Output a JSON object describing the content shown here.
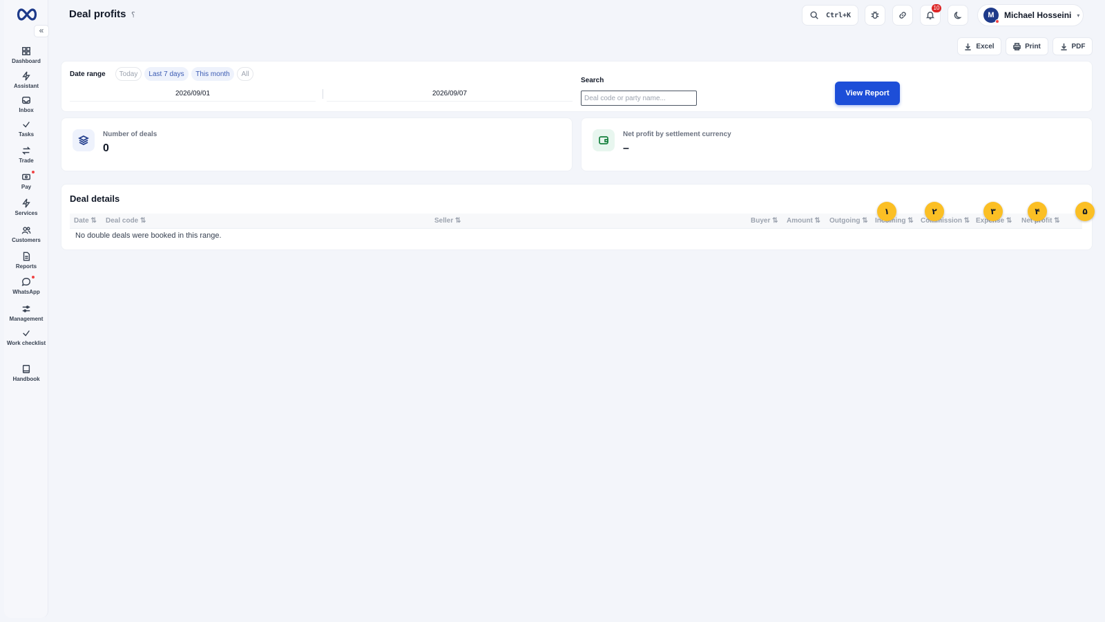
{
  "app": {
    "title": "Deal profits",
    "help": "؟"
  },
  "sidebar": {
    "collapse_label": "«",
    "items": [
      {
        "label": "Dashboard",
        "icon": "grid-icon"
      },
      {
        "label": "Assistant",
        "icon": "bolt-icon"
      },
      {
        "label": "Inbox",
        "icon": "inbox-icon"
      },
      {
        "label": "Tasks",
        "icon": "check-icon"
      },
      {
        "label": "Trade",
        "icon": "swap-icon"
      },
      {
        "label": "Pay",
        "icon": "wallet-icon"
      },
      {
        "label": "Services",
        "icon": "bolt-icon"
      },
      {
        "label": "Customers",
        "icon": "users-icon"
      },
      {
        "label": "Reports",
        "icon": "document-icon"
      },
      {
        "label": "WhatsApp",
        "icon": "chat-icon"
      },
      {
        "label": "Management",
        "icon": "sliders-icon"
      },
      {
        "label": "Work checklist",
        "icon": "check-icon"
      },
      {
        "label": "Handbook",
        "icon": "book-icon"
      }
    ]
  },
  "topbar": {
    "search_shortcut": "Ctrl+K",
    "notifications_count": "10",
    "user_initial": "M",
    "user_name": "Michael Hosseini",
    "caret": "▾"
  },
  "exports": {
    "excel": "Excel",
    "print": "Print",
    "pdf": "PDF"
  },
  "filters": {
    "date_range_label": "Date range",
    "chips": [
      {
        "label": "Today",
        "active": false
      },
      {
        "label": "Last 7 days",
        "active": true
      },
      {
        "label": "This month",
        "active": true
      },
      {
        "label": "All",
        "active": false
      }
    ],
    "date_from": "2026/09/01",
    "date_to": "2026/09/07",
    "search_label": "Search",
    "search_placeholder": "Deal code or party name...",
    "search_value": "",
    "view_report": "View Report"
  },
  "stats": [
    {
      "label": "Number of deals",
      "value": "0"
    },
    {
      "label": "Net profit by settlement currency",
      "value": "–"
    }
  ],
  "details": {
    "title": "Deal details",
    "columns": [
      "Date ⇅",
      "Deal code ⇅",
      "Seller ⇅",
      "Buyer ⇅",
      "Amount ⇅",
      "Outgoing ⇅",
      "Incoming ⇅",
      "Commission ⇅",
      "Expense ⇅",
      "Net profit ⇅"
    ],
    "empty": "No double deals were booked in this range."
  },
  "markers": [
    "١",
    "٢",
    "٣",
    "۴",
    "۵"
  ],
  "colors": {
    "primary": "#1d4ed8",
    "marker": "#fbbf24",
    "badge": "#dc2626"
  }
}
